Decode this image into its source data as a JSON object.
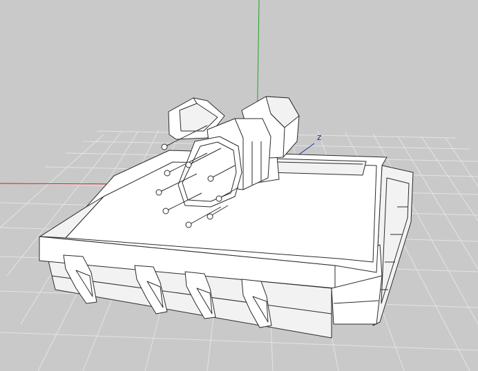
{
  "viewport": {
    "background": "#c9c9c9",
    "grid_color": "#e4e4e4",
    "axes": {
      "x": {
        "color": "#cc2020",
        "label": ""
      },
      "y": {
        "color": "#21a321",
        "label": ""
      },
      "z": {
        "color": "#1c2f9c",
        "label": "z"
      }
    },
    "model": {
      "description_shown": false,
      "render_style": "hidden-line wireframe",
      "fill": "#ffffff",
      "edge": "#2a2a2a"
    }
  }
}
